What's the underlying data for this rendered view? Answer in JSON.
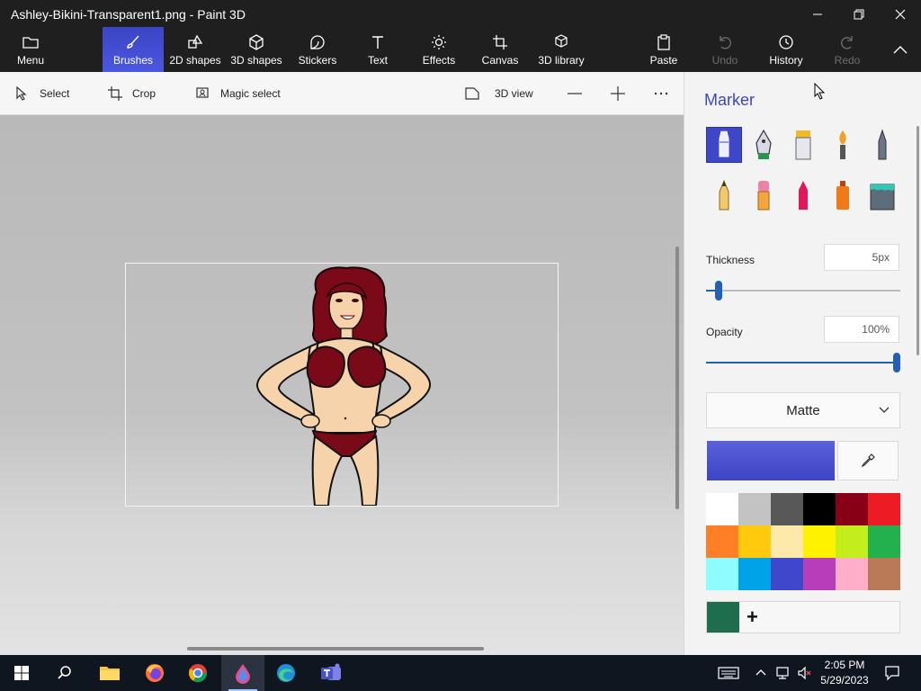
{
  "window": {
    "title": "Ashley-Bikini-Transparent1.png - Paint 3D"
  },
  "ribbon": {
    "tabs": [
      {
        "label": "Menu"
      },
      {
        "label": "Brushes"
      },
      {
        "label": "2D shapes"
      },
      {
        "label": "3D shapes"
      },
      {
        "label": "Stickers"
      },
      {
        "label": "Text"
      },
      {
        "label": "Effects"
      },
      {
        "label": "Canvas"
      },
      {
        "label": "3D library"
      },
      {
        "label": "Paste"
      },
      {
        "label": "Undo"
      },
      {
        "label": "History"
      },
      {
        "label": "Redo"
      }
    ],
    "active_tab": "Brushes",
    "accent": "#4b57e0"
  },
  "toolbar": {
    "select": "Select",
    "crop": "Crop",
    "magic_select": "Magic select",
    "view_3d": "3D view"
  },
  "panel": {
    "title": "Marker",
    "brushes": [
      "marker",
      "calligraphy-pen",
      "oil-brush",
      "watercolor",
      "pixel-pen",
      "pencil",
      "eraser",
      "crayon",
      "spray-can",
      "fill"
    ],
    "selected_brush": "marker",
    "thickness_label": "Thickness",
    "thickness_value": "5px",
    "thickness_fraction": 0.05,
    "opacity_label": "Opacity",
    "opacity_value": "100%",
    "opacity_fraction": 1.0,
    "finish": "Matte",
    "current_color": "#3d44c6",
    "palette": [
      "#ffffff",
      "#c3c3c3",
      "#585858",
      "#000000",
      "#880015",
      "#ed1c24",
      "#ff7f27",
      "#ffc90e",
      "#fde9a9",
      "#fff200",
      "#c4ed1c",
      "#22b14c",
      "#8ffcff",
      "#00a2e8",
      "#3f48cc",
      "#b83dba",
      "#ffaec9",
      "#b97a57"
    ],
    "custom_color": "#1e6e4e"
  },
  "taskbar": {
    "apps": [
      "start",
      "search",
      "file-explorer",
      "firefox",
      "chrome",
      "paint-3d",
      "edge",
      "teams"
    ],
    "time": "2:05 PM",
    "date": "5/29/2023"
  }
}
